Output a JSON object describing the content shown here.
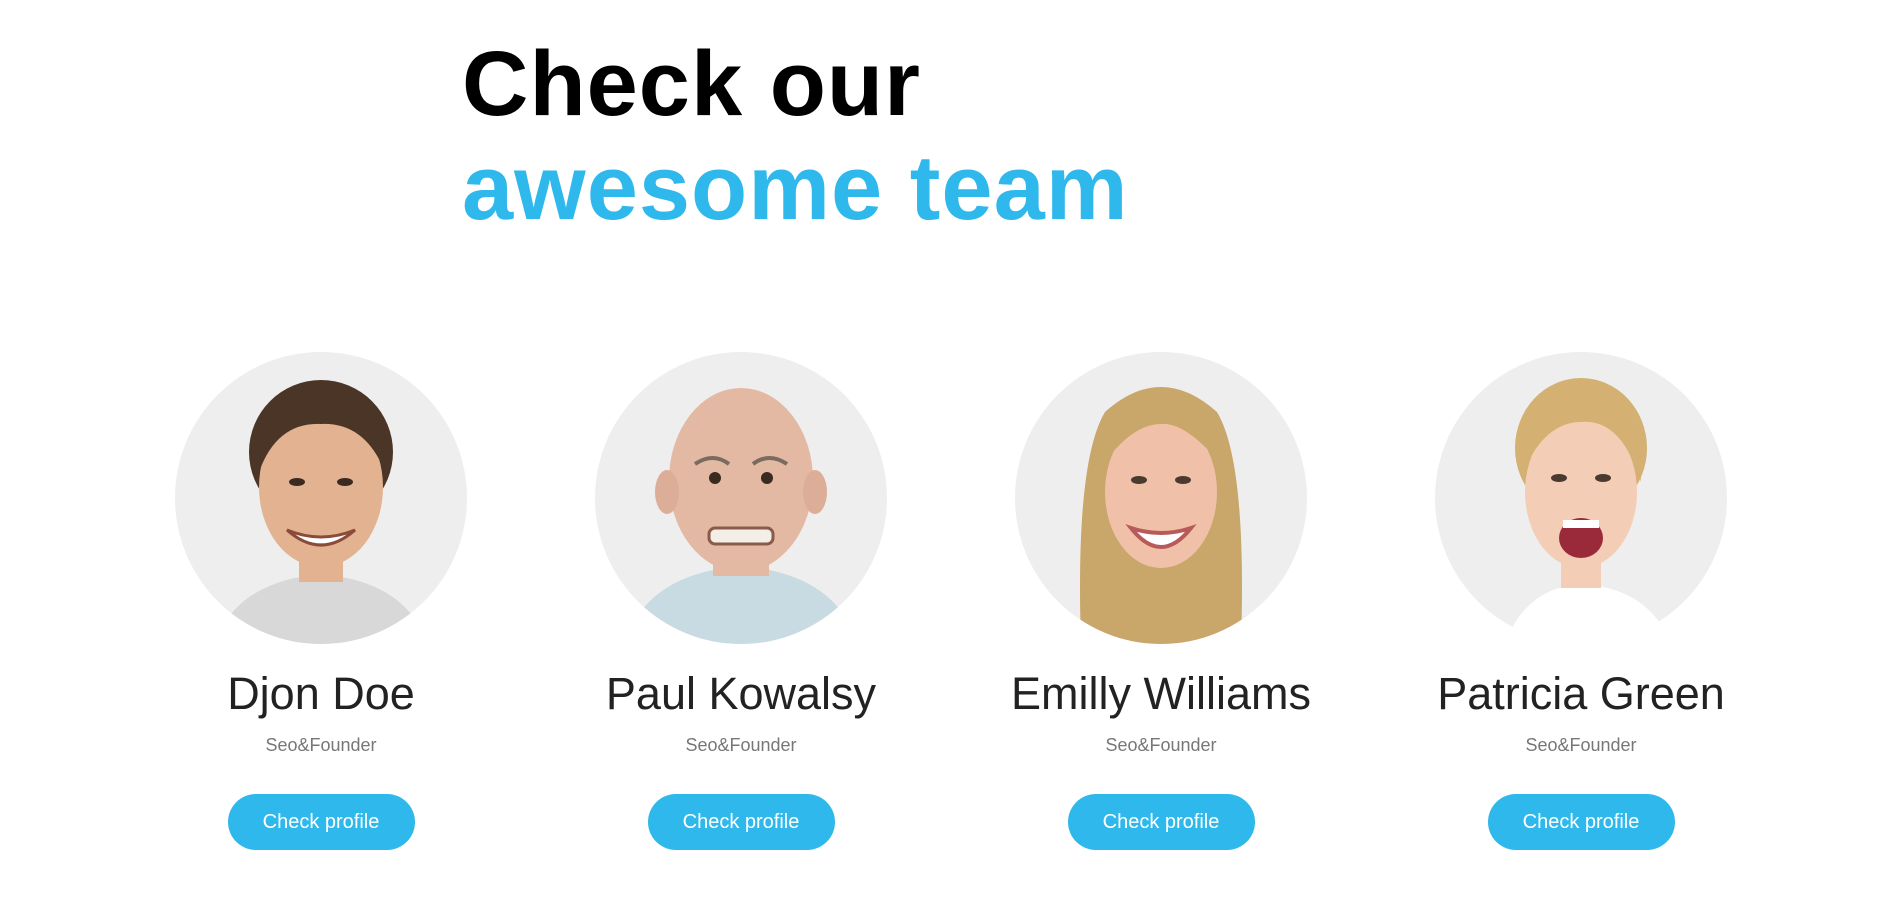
{
  "heading": {
    "line1": "Check our",
    "line2": "awesome team"
  },
  "colors": {
    "accent": "#2eb8ec",
    "avatar_bg": "#eeeeee",
    "name": "#222222",
    "role": "#777777"
  },
  "team": [
    {
      "name": "Djon Doe",
      "role": "Seo&Founder",
      "button_label": "Check profile",
      "photo": "smiling-young-man-photo",
      "skin": "#e2b291",
      "hair": "#4a3526",
      "shirt": "#d8d8d8"
    },
    {
      "name": "Paul Kowalsy",
      "role": "Seo&Founder",
      "button_label": "Check profile",
      "photo": "bald-old-man-photo",
      "skin": "#e4b9a3",
      "hair": "#e4b9a3",
      "shirt": "#c9dbe2"
    },
    {
      "name": "Emilly Williams",
      "role": "Seo&Founder",
      "button_label": "Check profile",
      "photo": "laughing-blonde-woman-photo",
      "skin": "#f0c1a8",
      "hair": "#c9a66a",
      "shirt": "#d8c9a8"
    },
    {
      "name": "Patricia Green",
      "role": "Seo&Founder",
      "button_label": "Check profile",
      "photo": "excited-blonde-woman-photo",
      "skin": "#f3cdb6",
      "hair": "#d4b072",
      "shirt": "#ffffff"
    }
  ]
}
